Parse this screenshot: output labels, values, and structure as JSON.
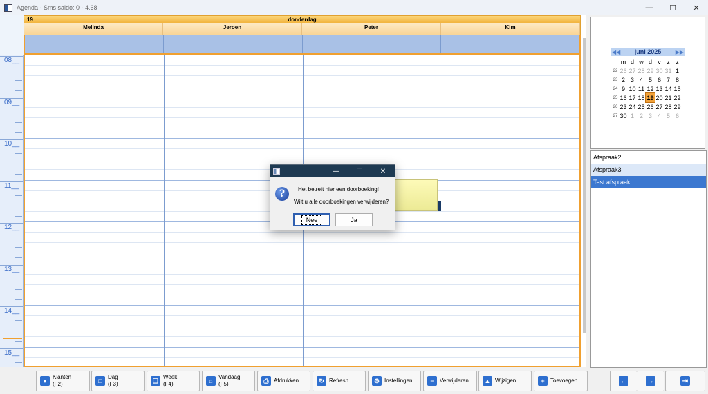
{
  "window": {
    "title": "Agenda - Sms saldo: 0 - 4.68",
    "controls": {
      "minimize": "—",
      "maximize": "☐",
      "close": "✕"
    }
  },
  "day_view": {
    "day_number": "19",
    "day_name": "donderdag",
    "resources": [
      "Melinda",
      "Jeroen",
      "Peter",
      "Kim"
    ],
    "hours": [
      "08__",
      "09__",
      "10__",
      "11__",
      "12__",
      "13__",
      "14__",
      "15__"
    ]
  },
  "mini_calendar": {
    "month_title": "juni 2025",
    "prev_nav": "◀◀",
    "next_nav": "▶▶",
    "weekdays": [
      "m",
      "d",
      "w",
      "d",
      "v",
      "z",
      "z"
    ],
    "weeks": [
      {
        "wk": "22",
        "days": [
          "26",
          "27",
          "28",
          "29",
          "30",
          "31",
          "1"
        ],
        "dim": [
          true,
          true,
          true,
          true,
          true,
          true,
          false
        ]
      },
      {
        "wk": "23",
        "days": [
          "2",
          "3",
          "4",
          "5",
          "6",
          "7",
          "8"
        ],
        "dim": [
          false,
          false,
          false,
          false,
          false,
          false,
          false
        ]
      },
      {
        "wk": "24",
        "days": [
          "9",
          "10",
          "11",
          "12",
          "13",
          "14",
          "15"
        ],
        "dim": [
          false,
          false,
          false,
          false,
          false,
          false,
          false
        ]
      },
      {
        "wk": "25",
        "days": [
          "16",
          "17",
          "18",
          "19",
          "20",
          "21",
          "22"
        ],
        "dim": [
          false,
          false,
          false,
          false,
          false,
          false,
          false
        ]
      },
      {
        "wk": "26",
        "days": [
          "23",
          "24",
          "25",
          "26",
          "27",
          "28",
          "29"
        ],
        "dim": [
          false,
          false,
          false,
          false,
          false,
          false,
          false
        ]
      },
      {
        "wk": "27",
        "days": [
          "30",
          "1",
          "2",
          "3",
          "4",
          "5",
          "6"
        ],
        "dim": [
          false,
          true,
          true,
          true,
          true,
          true,
          true
        ]
      }
    ],
    "selected_day": "19"
  },
  "appointments_list": [
    "Afspraak2",
    "Afspraak3",
    "Test afspraak"
  ],
  "toolbar": {
    "klanten": "Klanten\n(F2)",
    "dag": "Dag\n(F3)",
    "week": "Week\n(F4)",
    "vandaag": "Vandaag\n(F5)",
    "afdrukken": "Afdrukken",
    "refresh": "Refresh",
    "instellingen": "Instellingen",
    "verwijderen": "Verwijderen",
    "wijzigen": "Wijzigen",
    "toevoegen": "Toevoegen"
  },
  "dialog": {
    "line1": "Het betreft hier een doorboeking!",
    "line2": "Wilt u alle doorboekingen verwijderen?",
    "no_label": "Nee",
    "yes_label": "Ja",
    "icon": "?"
  },
  "colors": {
    "header_orange": "#f2b43f",
    "allday_blue": "#a9c1e6",
    "selected_blue": "#3c78d0",
    "dialog_title": "#1e3a52"
  }
}
